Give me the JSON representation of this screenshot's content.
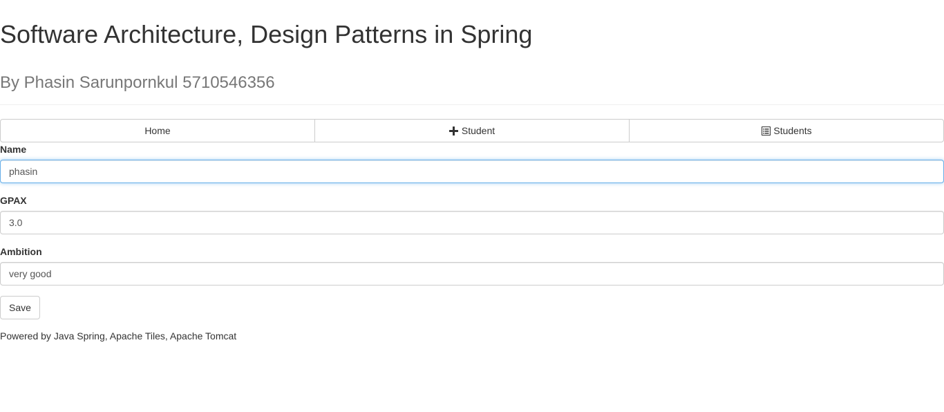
{
  "header": {
    "title": "Software Architecture, Design Patterns in Spring",
    "subtitle": "By Phasin Sarunpornkul 5710546356"
  },
  "nav": {
    "home_label": "Home",
    "add_student_label": "Student",
    "add_student_icon": "plus-icon",
    "students_label": "Students",
    "students_icon": "list-alt-icon"
  },
  "form": {
    "name": {
      "label": "Name",
      "value": "phasin"
    },
    "gpax": {
      "label": "GPAX",
      "value": "3.0"
    },
    "ambition": {
      "label": "Ambition",
      "value": "very good"
    },
    "save_label": "Save"
  },
  "footer": {
    "text": "Powered by Java Spring, Apache Tiles, Apache Tomcat"
  },
  "colors": {
    "text": "#333333",
    "muted": "#777777",
    "border": "#cccccc",
    "focus": "#66afe9"
  }
}
